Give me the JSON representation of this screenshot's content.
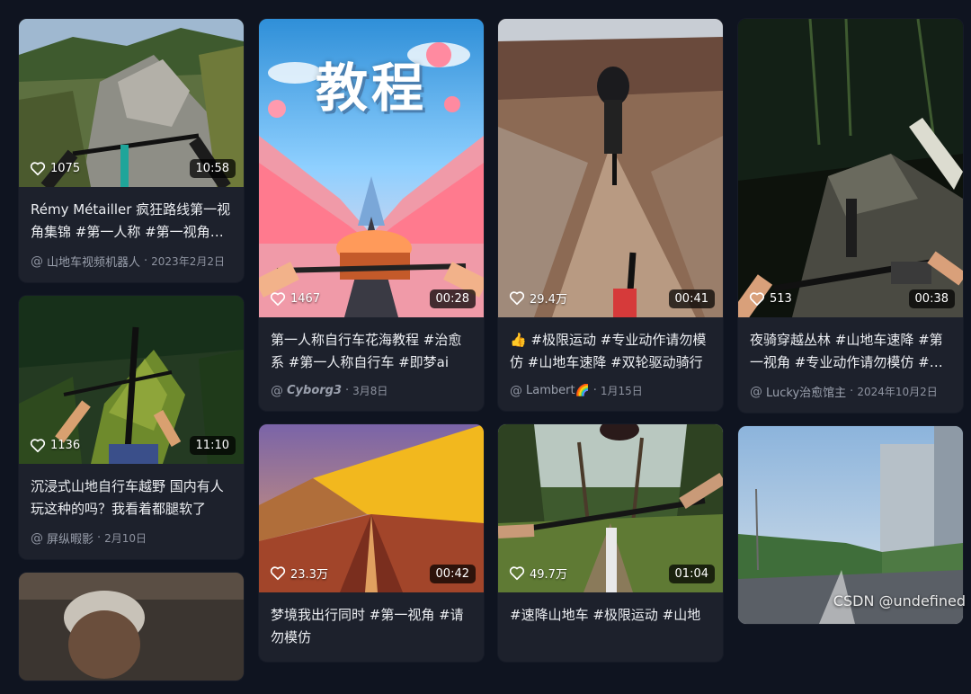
{
  "cards": [
    {
      "likes": "1075",
      "duration": "10:58",
      "caption": "Rémy Métailler 疯狂路线第一视角集锦 #第一人称 #第一视角骑行",
      "author": "山地车视频机器人",
      "date": "2023年2月2日"
    },
    {
      "likes": "1467",
      "duration": "00:28",
      "caption": "第一人称自行车花海教程 #治愈系 #第一人称自行车 #即梦ai",
      "author": "Cyborg3",
      "date": "3月8日",
      "overlay": "教程"
    },
    {
      "likes": "29.4万",
      "duration": "00:41",
      "caption": "👍 #极限运动 #专业动作请勿模仿 #山地车速降 #双轮驱动骑行",
      "author": "Lambert🌈",
      "date": "1月15日"
    },
    {
      "likes": "513",
      "duration": "00:38",
      "caption": "夜骑穿越丛林 #山地车速降 #第一视角 #专业动作请勿模仿 #山地车",
      "author": "Lucky治愈馆主",
      "date": "2024年10月2日"
    },
    {
      "likes": "1136",
      "duration": "11:10",
      "caption": "沉浸式山地自行车越野 国内有人玩这种的吗？我看着都腿软了",
      "author": "屏纵暇影",
      "date": "2月10日"
    },
    {
      "likes": "23.3万",
      "duration": "00:42",
      "caption": "梦境我出行同时 #第一视角 #请勿模仿",
      "author": "",
      "date": ""
    },
    {
      "likes": "49.7万",
      "duration": "01:04",
      "caption": "#速降山地车 #极限运动 #山地",
      "author": "",
      "date": ""
    },
    {
      "likes": "",
      "duration": "",
      "caption": "",
      "author": "",
      "date": ""
    }
  ],
  "watermark": "CSDN @undefined"
}
